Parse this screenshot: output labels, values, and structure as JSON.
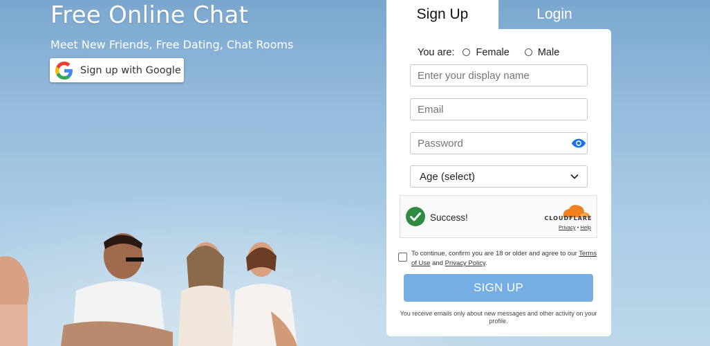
{
  "hero": {
    "title": "Free Online Chat",
    "subtitle": "Meet New Friends, Free Dating, Chat Rooms",
    "google_button": "Sign up with Google"
  },
  "tabs": [
    {
      "label": "Sign Up",
      "active": true
    },
    {
      "label": "Login",
      "active": false
    }
  ],
  "form": {
    "gender_label": "You are:",
    "gender_options": [
      "Female",
      "Male"
    ],
    "display_name_placeholder": "Enter your display name",
    "email_placeholder": "Email",
    "password_placeholder": "Password",
    "age_select": "Age (select)",
    "captcha": {
      "status": "Success!",
      "brand": "CLOUDFLARE",
      "privacy": "Privacy",
      "separator": "•",
      "help": "Help"
    },
    "agreement": {
      "text_before": "To continue, confirm you are 18 or older and agree to our",
      "terms": "Terms of Use",
      "and": "and",
      "privacy": "Privacy Policy",
      "end": "."
    },
    "submit": "SIGN UP",
    "footer": "You receive emails only about new messages and other activity on your profile."
  },
  "colors": {
    "button": "#76aee3",
    "eye_icon": "#1a73e8",
    "success": "#2e8b3f",
    "cloudflare": "#f38020"
  }
}
